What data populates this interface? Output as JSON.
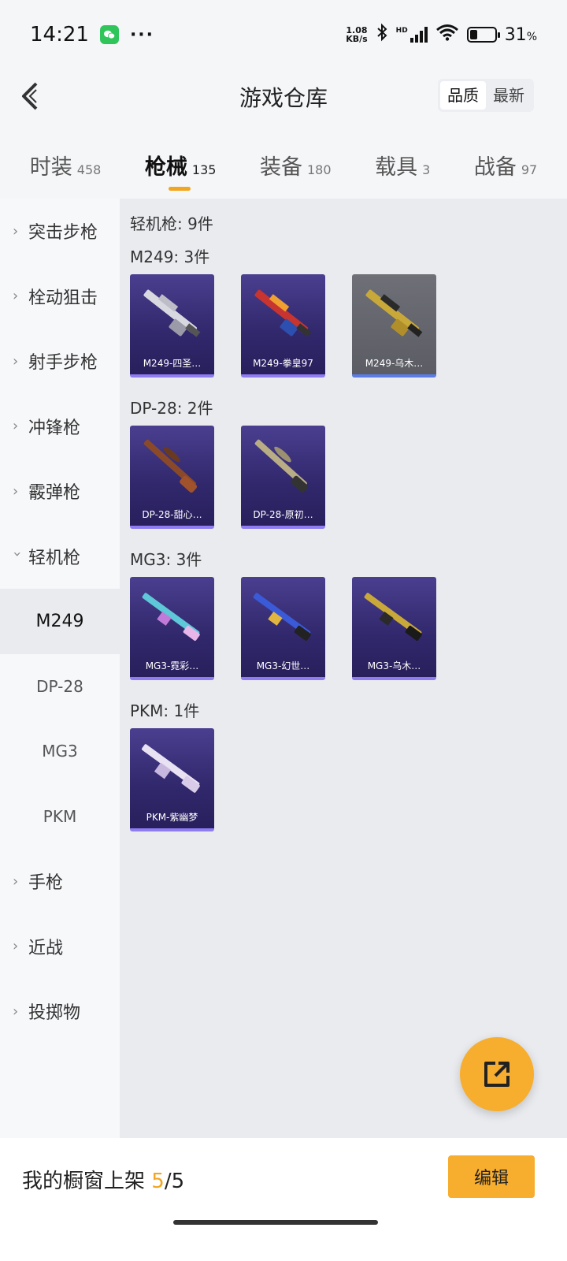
{
  "status_bar": {
    "time": "14:21",
    "dots": "···",
    "net_speed_value": "1.08",
    "net_speed_unit": "KB/s",
    "hd_label": "HD",
    "battery_percent": "31",
    "battery_unit": "%",
    "battery_level": 0.31
  },
  "header": {
    "title": "游戏仓库",
    "sort_options": [
      "品质",
      "最新"
    ]
  },
  "tabs": [
    {
      "label": "时装",
      "count": "458"
    },
    {
      "label": "枪械",
      "count": "135"
    },
    {
      "label": "装备",
      "count": "180"
    },
    {
      "label": "载具",
      "count": "3"
    },
    {
      "label": "战备",
      "count": "97"
    }
  ],
  "sidebar": {
    "categories_top": [
      "突击步枪",
      "栓动狙击",
      "射手步枪",
      "冲锋枪",
      "霰弹枪"
    ],
    "expanded": "轻机枪",
    "subitems": [
      "M249",
      "DP-28",
      "MG3",
      "PKM"
    ],
    "categories_bottom": [
      "手枪",
      "近战",
      "投掷物"
    ]
  },
  "content": {
    "total": "轻机枪: 9件",
    "groups": [
      {
        "title": "M249: 3件",
        "items": [
          "M249-四圣…",
          "M249-拳皇97",
          "M249-乌木…"
        ]
      },
      {
        "title": "DP-28: 2件",
        "items": [
          "DP-28-甜心…",
          "DP-28-原初…"
        ]
      },
      {
        "title": "MG3: 3件",
        "items": [
          "MG3-霓彩…",
          "MG3-幻世…",
          "MG3-乌木…"
        ]
      },
      {
        "title": "PKM: 1件",
        "items": [
          "PKM-紫幽梦"
        ]
      }
    ]
  },
  "bottom_bar": {
    "label": "我的橱窗上架",
    "count_current": "5",
    "count_sep": "/",
    "count_total": "5",
    "edit_label": "编辑"
  },
  "colors": {
    "accent": "#f7ad2d",
    "card_purple": "#32296e",
    "card_gray": "#5b5c64"
  }
}
